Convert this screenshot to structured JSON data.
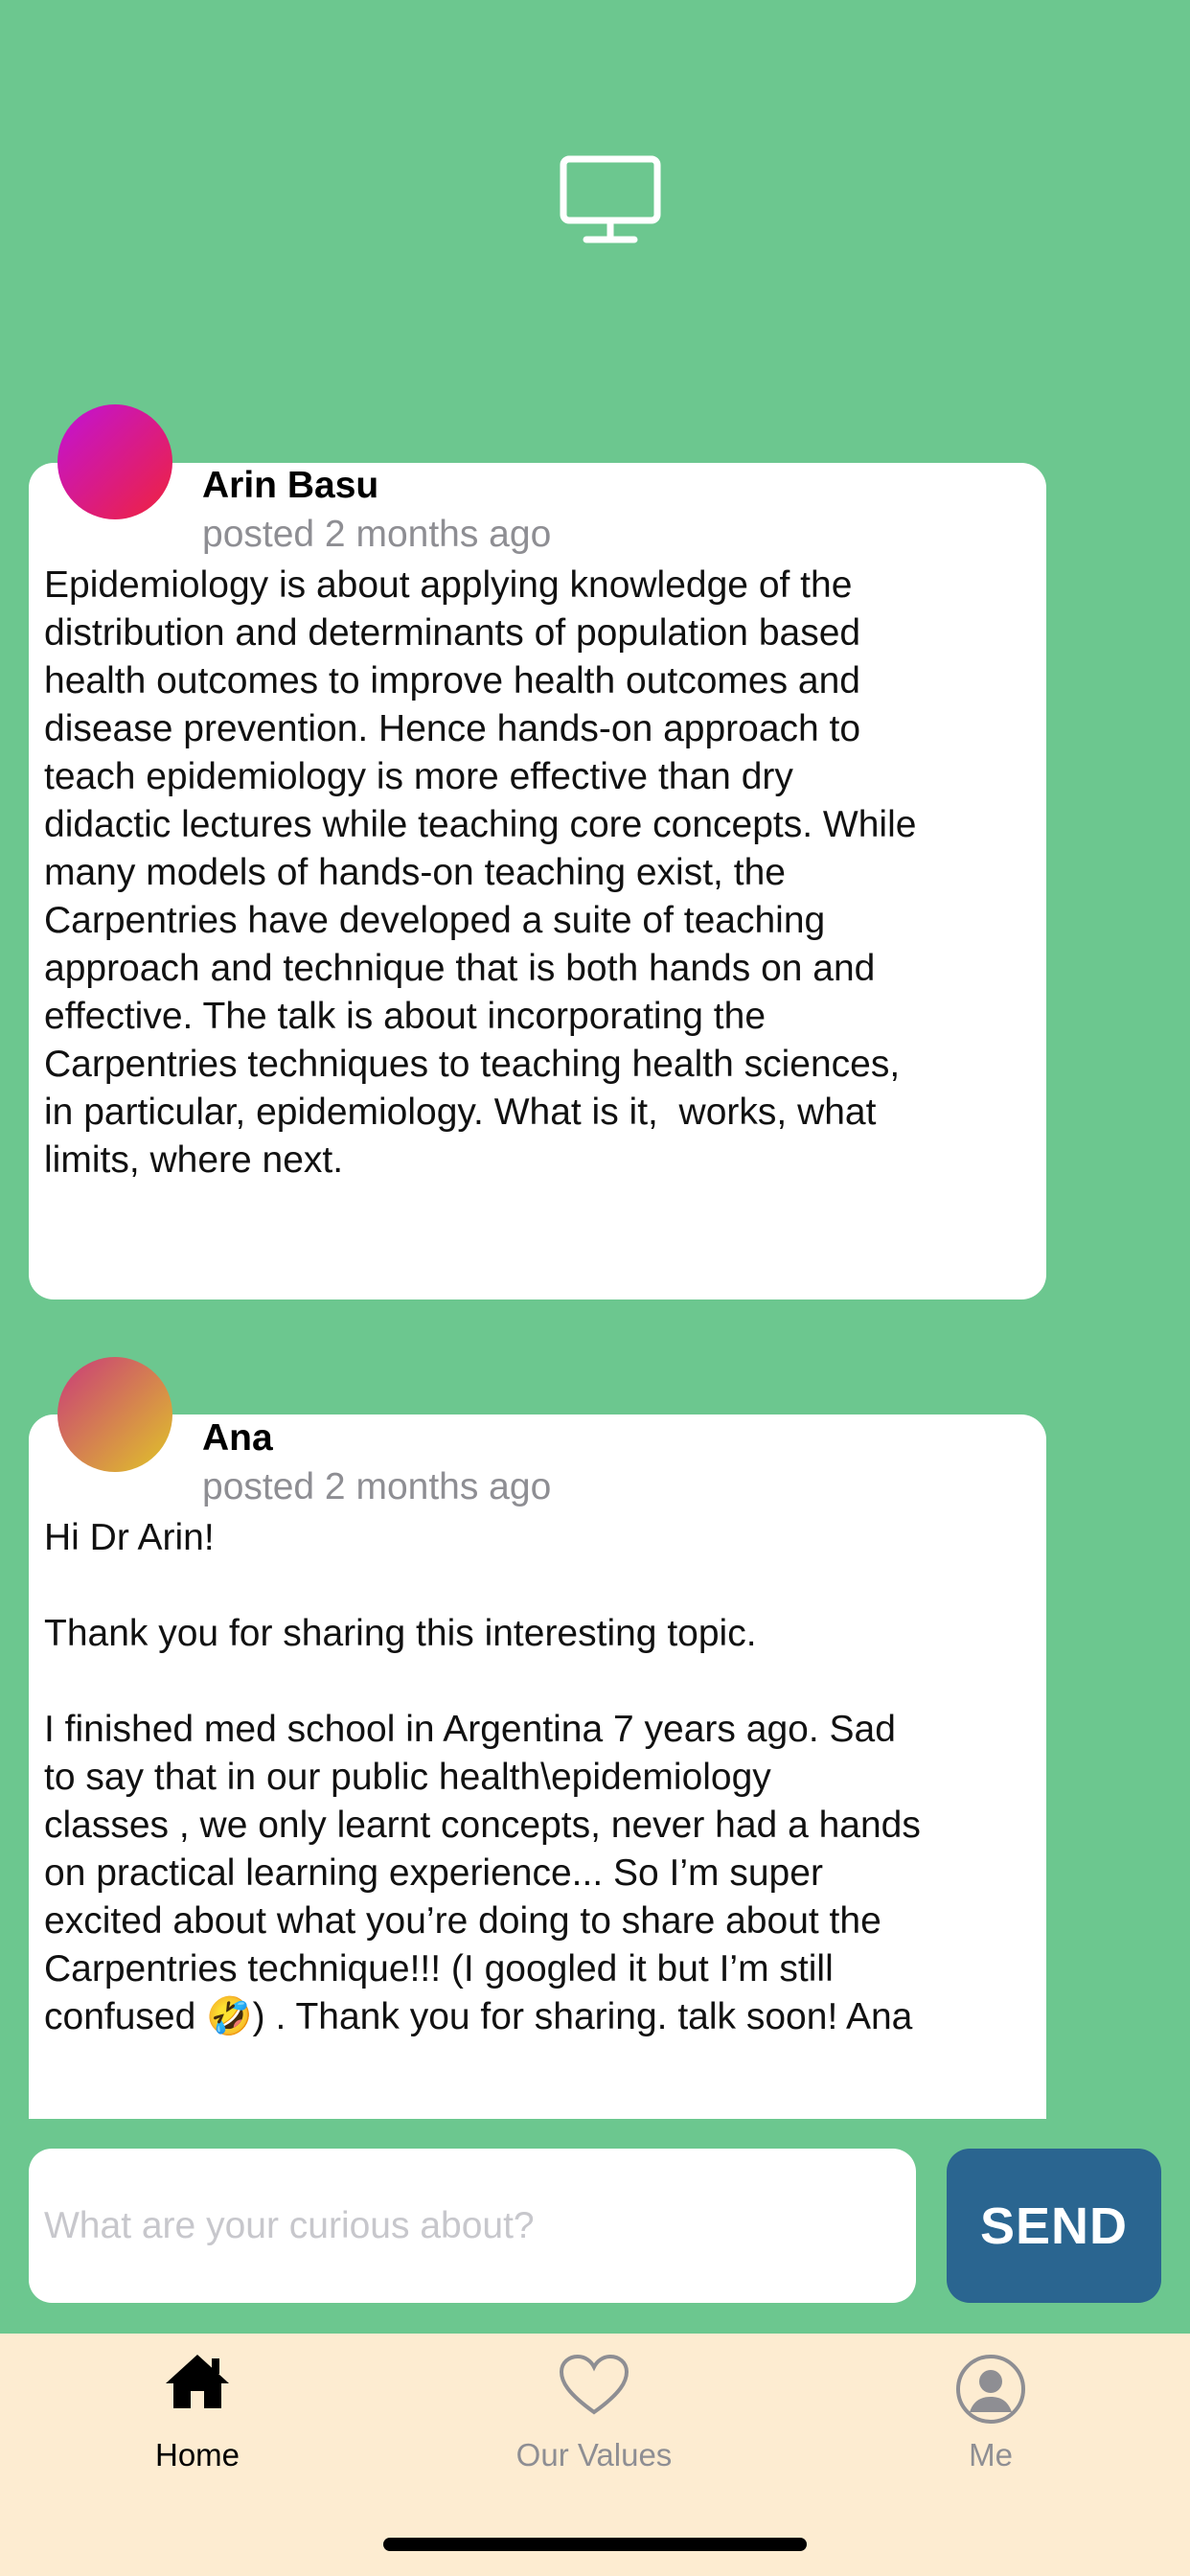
{
  "header": {
    "icon": "monitor-icon"
  },
  "posts": [
    {
      "author": "Arin Basu",
      "posted": "posted 2 months ago",
      "avatar_gradient": [
        "#c012d8",
        "#f0233c"
      ],
      "body": "Epidemiology is about applying knowledge of the\ndistribution and determinants of population based\nhealth outcomes to improve health outcomes and\ndisease prevention. Hence hands-on approach to\nteach epidemiology is more effective than dry\ndidactic lectures while teaching core concepts. While\nmany models of hands-on teaching exist, the\nCarpentries have developed a suite of teaching\napproach and technique that is both hands on and\neffective. The talk is about incorporating the\nCarpentries techniques to teaching health sciences,\nin particular, epidemiology. What is it,  works, what\nlimits, where next."
    },
    {
      "author": "Ana",
      "posted": "posted 2 months ago",
      "avatar_gradient": [
        "#c93a7a",
        "#e0c528"
      ],
      "body": "Hi Dr Arin!\n\nThank you for sharing this interesting topic.\n\nI finished med school in Argentina 7 years ago. Sad\nto say that in our public health\\epidemiology\nclasses , we only learnt concepts, never had a hands\non practical learning experience... So I’m super\nexcited about what you’re doing to share about the\nCarpentries technique!!! (I googled it but I’m still\nconfused 🤣) . Thank you for sharing. talk soon! Ana"
    }
  ],
  "composer": {
    "placeholder": "What are your curious about?",
    "value": ""
  },
  "send": {
    "label": "SEND",
    "color": "#2a6590"
  },
  "tabs": [
    {
      "label": "Home",
      "icon": "home-icon",
      "active": true
    },
    {
      "label": "Our Values",
      "icon": "heart-icon",
      "active": false
    },
    {
      "label": "Me",
      "icon": "user-icon",
      "active": false
    }
  ],
  "colors": {
    "background": "#6cc78f",
    "tabbar": "#fdecd1",
    "inactive": "#8e8e93"
  }
}
